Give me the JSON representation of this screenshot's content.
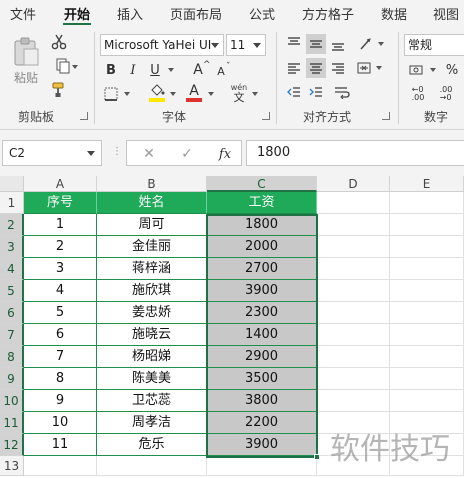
{
  "ribbon": {
    "tabs": [
      "文件",
      "开始",
      "插入",
      "页面布局",
      "公式",
      "方方格子",
      "数据",
      "视图"
    ],
    "active_tab": "开始",
    "clipboard": {
      "paste_label": "粘贴",
      "group_label": "剪贴板"
    },
    "font": {
      "name": "Microsoft YaHei UI",
      "size": "11",
      "bold": "B",
      "italic": "I",
      "underline": "U",
      "grow": "A",
      "shrink": "A",
      "font_color_glyph": "A",
      "phonetic": "wén",
      "group_label": "字体"
    },
    "alignment": {
      "group_label": "对齐方式"
    },
    "number": {
      "format": "常规",
      "group_label": "数字"
    }
  },
  "formula_bar": {
    "name_box": "C2",
    "cancel_glyph": "✕",
    "enter_glyph": "✓",
    "fx_glyph": "fx",
    "value": "1800"
  },
  "sheet": {
    "columns": [
      "A",
      "B",
      "C",
      "D",
      "E"
    ],
    "rows": [
      "1",
      "2",
      "3",
      "4",
      "5",
      "6",
      "7",
      "8",
      "9",
      "10",
      "11",
      "12",
      "13"
    ],
    "headers": [
      "序号",
      "姓名",
      "工资"
    ],
    "data": [
      [
        "1",
        "周可",
        "1800"
      ],
      [
        "2",
        "金佳丽",
        "2000"
      ],
      [
        "3",
        "蒋梓涵",
        "2700"
      ],
      [
        "4",
        "施欣琪",
        "3900"
      ],
      [
        "5",
        "姜忠娇",
        "2300"
      ],
      [
        "6",
        "施晓云",
        "1400"
      ],
      [
        "7",
        "杨昭娣",
        "2900"
      ],
      [
        "8",
        "陈美美",
        "3500"
      ],
      [
        "9",
        "卫芯蕊",
        "3800"
      ],
      [
        "10",
        "周孝洁",
        "2200"
      ],
      [
        "11",
        "危乐",
        "3900"
      ]
    ]
  },
  "watermark": "软件技巧",
  "colors": {
    "header_fill": "#1faa59",
    "selection": "#1e7145",
    "selected_fill": "#c8c8c8"
  }
}
